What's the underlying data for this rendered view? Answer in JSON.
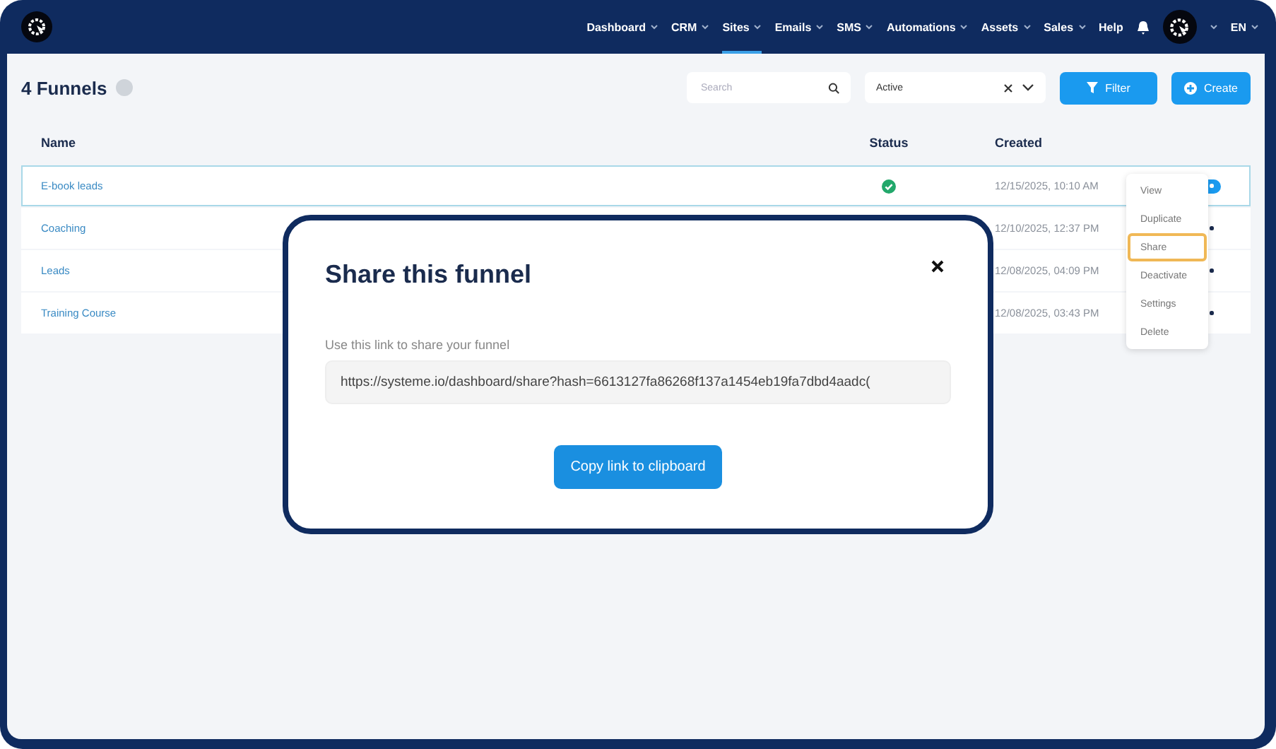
{
  "nav": {
    "items": [
      {
        "label": "Dashboard",
        "caret": true,
        "selected": false
      },
      {
        "label": "CRM",
        "caret": true,
        "selected": false
      },
      {
        "label": "Sites",
        "caret": true,
        "selected": true
      },
      {
        "label": "Emails",
        "caret": true,
        "selected": false
      },
      {
        "label": "SMS",
        "caret": true,
        "selected": false
      },
      {
        "label": "Automations",
        "caret": true,
        "selected": false
      },
      {
        "label": "Assets",
        "caret": true,
        "selected": false
      },
      {
        "label": "Sales",
        "caret": true,
        "selected": false
      },
      {
        "label": "Help",
        "caret": false,
        "selected": false
      }
    ],
    "language": "EN"
  },
  "page": {
    "title": "4 Funnels",
    "search": {
      "placeholder": "Search"
    },
    "status_filter": {
      "value": "Active"
    },
    "filter_button": "Filter",
    "create_button": "Create"
  },
  "table": {
    "columns": [
      "Name",
      "Status",
      "Created"
    ],
    "rows": [
      {
        "name": "E-book leads",
        "active": true,
        "created": "12/15/2025, 10:10 AM",
        "selected": true,
        "menu_open": true
      },
      {
        "name": "Coaching",
        "created": "12/10/2025, 12:37 PM",
        "selected": false,
        "menu_open": false
      },
      {
        "name": "Leads",
        "created": "12/08/2025, 04:09 PM",
        "selected": false,
        "menu_open": false
      },
      {
        "name": "Training Course",
        "created": "12/08/2025, 03:43 PM",
        "selected": false,
        "menu_open": false
      }
    ]
  },
  "row_menu": {
    "items": [
      {
        "label": "View",
        "highlighted": false
      },
      {
        "label": "Duplicate",
        "highlighted": false
      },
      {
        "label": "Share",
        "highlighted": true
      },
      {
        "label": "Deactivate",
        "highlighted": false
      },
      {
        "label": "Settings",
        "highlighted": false
      },
      {
        "label": "Delete",
        "highlighted": false
      }
    ]
  },
  "dialog": {
    "title": "Share this funnel",
    "label": "Use this link to share your funnel",
    "link": "https://systeme.io/dashboard/share?hash=6613127fa86268f137a1454eb19fa7dbd4aadc(",
    "button": "Copy link to clipboard"
  }
}
